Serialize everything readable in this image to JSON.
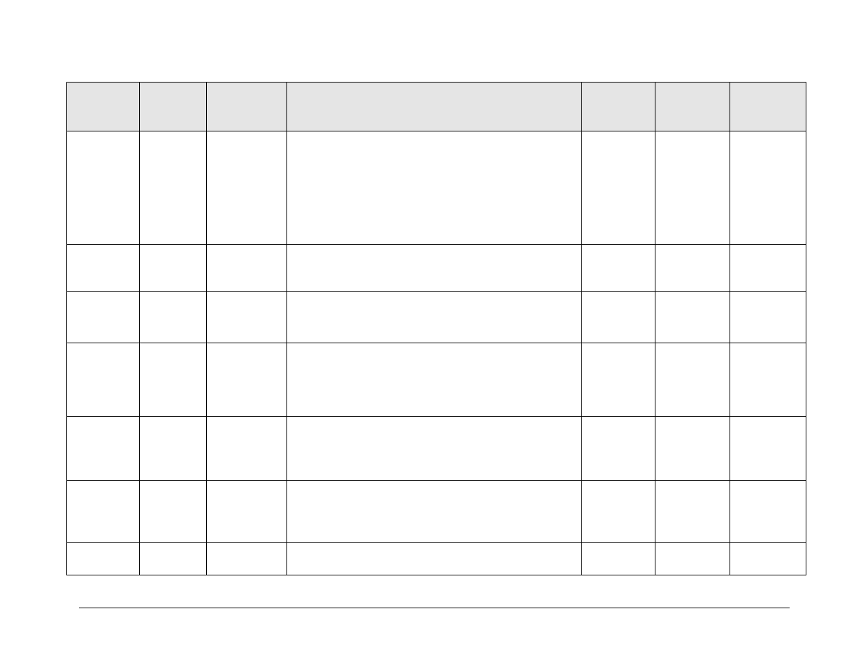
{
  "table": {
    "headers": [
      "",
      "",
      "",
      "",
      "",
      "",
      ""
    ],
    "rows": [
      [
        "",
        "",
        "",
        "",
        "",
        "",
        ""
      ],
      [
        "",
        "",
        "",
        "",
        "",
        "",
        ""
      ],
      [
        "",
        "",
        "",
        "",
        "",
        "",
        ""
      ],
      [
        "",
        "",
        "",
        "",
        "",
        "",
        ""
      ],
      [
        "",
        "",
        "",
        "",
        "",
        "",
        ""
      ],
      [
        "",
        "",
        "",
        "",
        "",
        "",
        ""
      ],
      [
        "",
        "",
        "",
        "",
        "",
        "",
        ""
      ]
    ]
  }
}
